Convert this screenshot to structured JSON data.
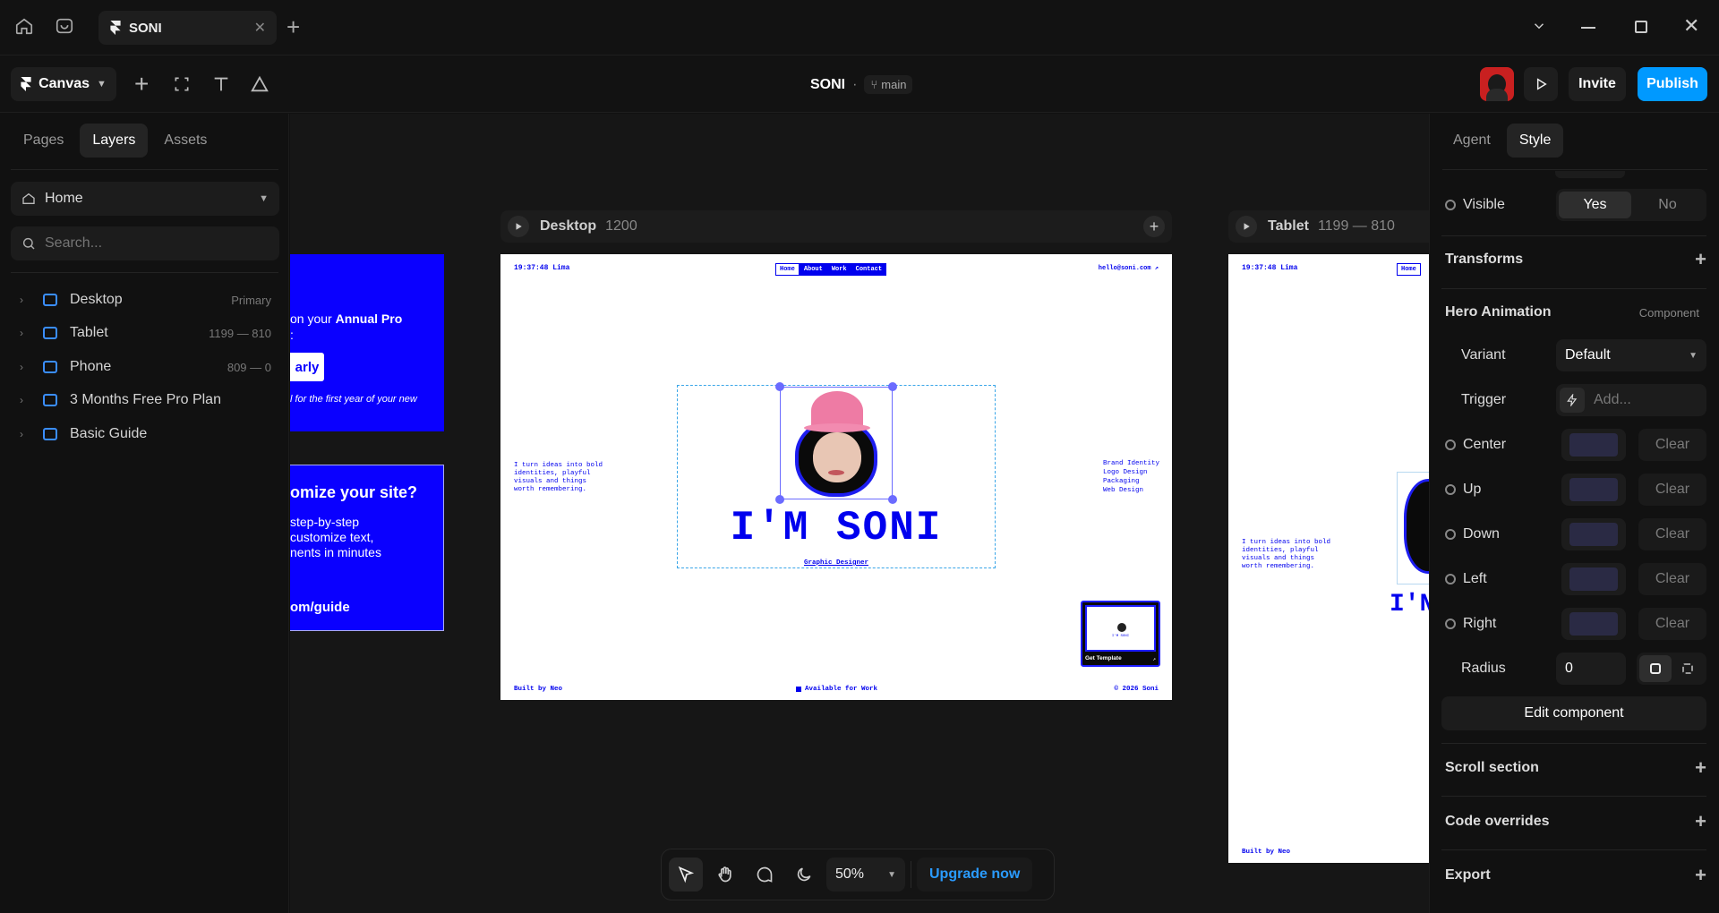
{
  "titlebar": {
    "tab_title": "SONI"
  },
  "toolbar": {
    "mode_label": "Canvas",
    "project_title": "SONI",
    "branch": "main",
    "invite_label": "Invite",
    "publish_label": "Publish"
  },
  "left_panel": {
    "tabs": [
      "Pages",
      "Layers",
      "Assets"
    ],
    "active_tab": "Layers",
    "page_select": "Home",
    "search_placeholder": "Search...",
    "layers": [
      {
        "name": "Desktop",
        "meta": "Primary"
      },
      {
        "name": "Tablet",
        "meta": "1199 — 810"
      },
      {
        "name": "Phone",
        "meta": "809 — 0"
      },
      {
        "name": "3 Months Free Pro Plan",
        "meta": ""
      },
      {
        "name": "Basic Guide",
        "meta": ""
      }
    ]
  },
  "canvas": {
    "promo_card": {
      "line1": "on your",
      "line1_bold": "Annual Pro",
      "line2": ":",
      "button": "arly",
      "note": "l for the first year of your new"
    },
    "guide_card": {
      "title": "omize your site?",
      "body1": "step-by-step",
      "body2": "customize text,",
      "body3": "nents in minutes",
      "link": "om/guide"
    },
    "desktop": {
      "label": "Desktop",
      "width": "1200",
      "time": "19:37:48 Lima",
      "nav": [
        "Home",
        "About",
        "Work",
        "Contact"
      ],
      "email": "hello@soni.com ↗",
      "intro": [
        "I turn ideas into bold",
        "identities, playful",
        "visuals and things",
        "worth remembering."
      ],
      "services": [
        "Brand Identity",
        "Logo Design",
        "Packaging",
        "Web Design"
      ],
      "hero_title": "I'M SONI",
      "hero_subtitle": "Graphic Designer",
      "footer_left": "Built by Neo",
      "footer_center": "Available for Work",
      "footer_right": "© 2026 Soni",
      "template_btn": "Get Template",
      "template_hero": "I'M SONI"
    },
    "tablet": {
      "label": "Tablet",
      "range": "1199 — 810",
      "time": "19:37:48 Lima",
      "nav_first": "Home",
      "intro": [
        "I turn ideas into bold",
        "identities, playful",
        "visuals and things",
        "worth remembering."
      ],
      "hero_partial": "I'N",
      "footer_left": "Built by Neo"
    }
  },
  "bottom_bar": {
    "zoom": "50%",
    "upgrade_label": "Upgrade now"
  },
  "right_panel": {
    "tabs": [
      "Agent",
      "Style"
    ],
    "active_tab": "Style",
    "visible_label": "Visible",
    "visible_yes": "Yes",
    "visible_no": "No",
    "transforms": "Transforms",
    "hero_animation": "Hero Animation",
    "component_tag": "Component",
    "variant_label": "Variant",
    "variant_value": "Default",
    "trigger_label": "Trigger",
    "trigger_placeholder": "Add...",
    "states": [
      "Center",
      "Up",
      "Down",
      "Left",
      "Right"
    ],
    "clear_label": "Clear",
    "radius_label": "Radius",
    "radius_value": "0",
    "edit_component": "Edit component",
    "scroll_section": "Scroll section",
    "code_overrides": "Code overrides",
    "export": "Export"
  },
  "colors": {
    "accent_blue": "#0099ff",
    "site_blue": "#0000ee",
    "selection": "#6b6bff"
  }
}
